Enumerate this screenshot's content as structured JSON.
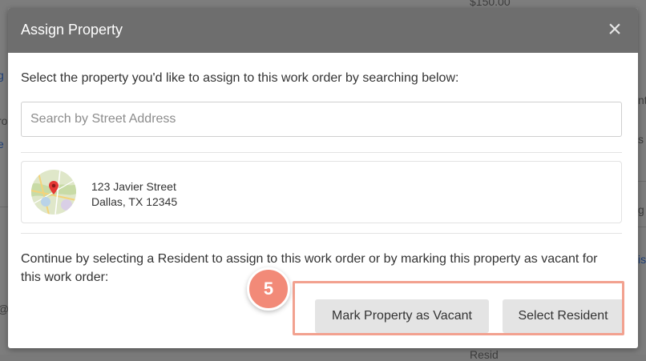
{
  "modal": {
    "title": "Assign Property",
    "close_glyph": "×",
    "instruction": "Select the property you'd like to assign to this work order by searching below:",
    "search": {
      "placeholder": "Search by Street Address",
      "value": ""
    },
    "property": {
      "line1": "123 Javier Street",
      "line2": "Dallas, TX 12345",
      "thumbnail_icon": "map-pin-icon"
    },
    "continue_text": "Continue by selecting a Resident to assign to this work order or by marking this property as vacant for this work order:",
    "buttons": {
      "vacant": "Mark Property as Vacant",
      "resident": "Select Resident"
    }
  },
  "annotation": {
    "step_number": "5",
    "color": "#f28a78"
  },
  "colors": {
    "header": "#6e6e6e",
    "button_bg": "#e4e4e4",
    "highlight": "#f2a18f"
  }
}
